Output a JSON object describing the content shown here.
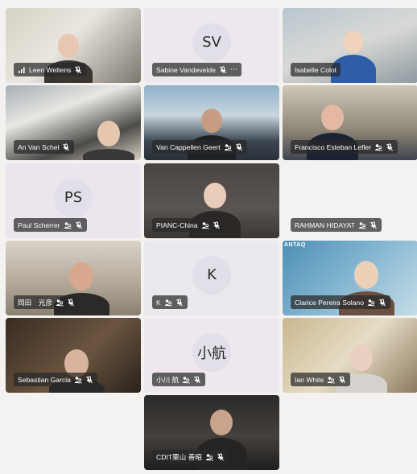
{
  "participants": [
    {
      "name": "Leen Weltens",
      "initials": "",
      "signal": true,
      "more": false,
      "people_icon": false,
      "muted": true
    },
    {
      "name": "Sabine Vandevelde",
      "initials": "SV",
      "signal": false,
      "more": true,
      "people_icon": false,
      "muted": true
    },
    {
      "name": "Isabelle Colot",
      "initials": "",
      "signal": false,
      "more": false,
      "people_icon": false,
      "muted": false,
      "active": true
    },
    {
      "name": "An Van Schel",
      "initials": "",
      "signal": false,
      "more": false,
      "people_icon": false,
      "muted": true
    },
    {
      "name": "Van Cappellen Geert",
      "initials": "",
      "signal": false,
      "more": false,
      "people_icon": true,
      "muted": true
    },
    {
      "name": "Francisco Esteban Lefler",
      "initials": "",
      "signal": false,
      "more": false,
      "people_icon": true,
      "muted": true
    },
    {
      "name": "Paul Scherrer",
      "initials": "PS",
      "signal": false,
      "more": false,
      "people_icon": true,
      "muted": true
    },
    {
      "name": "PIANC-China",
      "initials": "",
      "signal": false,
      "more": false,
      "people_icon": true,
      "muted": true
    },
    {
      "name": "RAHMAN HIDAYAT",
      "initials": "",
      "signal": false,
      "more": false,
      "people_icon": true,
      "muted": true
    },
    {
      "name": "岡田　光彦",
      "initials": "",
      "signal": false,
      "more": false,
      "people_icon": true,
      "muted": true
    },
    {
      "name": "K",
      "initials": "K",
      "signal": false,
      "more": false,
      "people_icon": true,
      "muted": true
    },
    {
      "name": "Clarice Pereira Solano",
      "initials": "",
      "signal": false,
      "more": false,
      "people_icon": true,
      "muted": true
    },
    {
      "name": "Sebastian Garcia",
      "initials": "",
      "signal": false,
      "more": false,
      "people_icon": true,
      "muted": true
    },
    {
      "name": "小川 航",
      "initials": "小航",
      "signal": false,
      "more": false,
      "people_icon": true,
      "muted": true
    },
    {
      "name": "Ian White",
      "initials": "",
      "signal": false,
      "more": false,
      "people_icon": true,
      "muted": true
    },
    {
      "name": "CDIT栗山 善昭",
      "initials": "",
      "signal": false,
      "more": false,
      "people_icon": true,
      "muted": true
    }
  ],
  "watermark_text": "ANTAQ",
  "colors": {
    "active_border": "#6b6fd1",
    "label_bg": "#282828",
    "avatar_bg": "#e2dfe8"
  }
}
